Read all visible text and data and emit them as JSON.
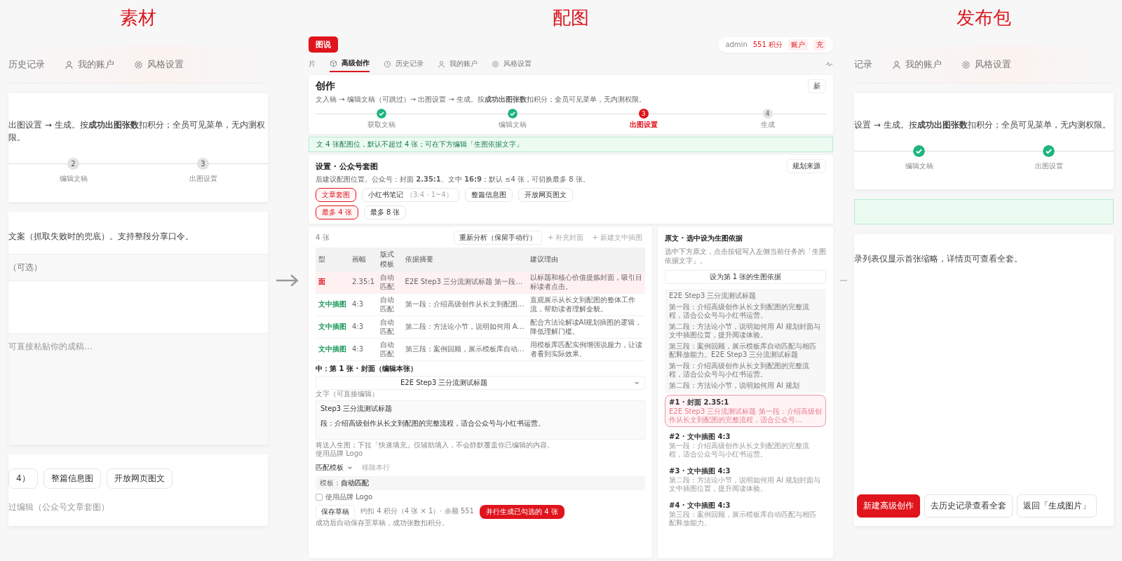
{
  "source_panel": {
    "title": "素材",
    "nav": [
      {
        "label": "历史记录",
        "kind": "plain",
        "selected": false
      },
      {
        "label": "我的账户",
        "kind": "account",
        "selected": false
      },
      {
        "label": "风格设置",
        "kind": "style",
        "selected": false
      }
    ],
    "intro": "出图设置 → 生成。按**成功出图张数**扣积分；全员可见菜单，无内测权限。",
    "steps": [
      {
        "number": "2",
        "label": "编辑文稿",
        "done": false,
        "current": false
      },
      {
        "number": "3",
        "label": "出图设置",
        "done": false,
        "current": false
      }
    ],
    "source_hint": "文案（抓取失败时的兜底）。支持整段分享口令。",
    "optional_label": "（可选）",
    "draft_placeholder": "可直接粘贴你的成稿…",
    "format_chips": [
      {
        "label": "4）",
        "selected": false
      },
      {
        "label": "整篇信息图",
        "selected": false
      },
      {
        "label": "开放网页图文",
        "selected": false
      }
    ],
    "footer_text": "过编辑（公众号文章套图）"
  },
  "figure_panel": {
    "title": "配图",
    "header": {
      "logo": "图说",
      "user": "admin",
      "points": "551 积分",
      "links": [
        "账户",
        "充"
      ]
    },
    "nav": [
      {
        "label": "片",
        "kind": "plain",
        "selected": false
      },
      {
        "label": "高级创作",
        "kind": "create",
        "selected": true
      },
      {
        "label": "历史记录",
        "kind": "history",
        "selected": false
      },
      {
        "label": "我的账户",
        "kind": "account",
        "selected": false
      },
      {
        "label": "风格设置",
        "kind": "style",
        "selected": false
      }
    ],
    "create_card": {
      "title": "创作",
      "action": "新",
      "intro": "文入稿 → 编辑文稿（可跳过）→ 出图设置 → 生成。按**成功出图张数**扣积分；全员可见菜单，无内测权限。",
      "steps": [
        {
          "label": "获取文稿",
          "done": true,
          "current": false
        },
        {
          "label": "编辑文稿",
          "done": true,
          "current": false
        },
        {
          "number": "3",
          "label": "出图设置",
          "done": false,
          "current": true
        },
        {
          "number": "4",
          "label": "生成",
          "done": false,
          "current": false
        }
      ]
    },
    "banner": "文 4 张配图位，默认不超过 4 张；可在下方编辑「生图依据文字」",
    "settings_card": {
      "title": "设置 · 公众号套图",
      "action": "规划来源",
      "intro": "后建议配图位置。公众号：封面 **2.35:1**、文中 **16:9**；默认 ≤4 张，可切换最多 8 张。",
      "format_chips": [
        {
          "label": "文章套图",
          "selected": true
        },
        {
          "label": "小红书笔记",
          "note": "（3:4 · 1~4）",
          "selected": false
        },
        {
          "label": "整篇信息图",
          "selected": false
        },
        {
          "label": "开放网页图文",
          "selected": false
        }
      ],
      "count_chips": [
        {
          "label": "最多 4 张",
          "selected": true
        },
        {
          "label": "最多 8 张",
          "selected": false
        }
      ]
    },
    "plan": {
      "count": "4 张",
      "actions": [
        {
          "label": "重新分析（保留手动行）",
          "kind": "secondary"
        },
        {
          "label": "+ 补充封面",
          "kind": "link"
        },
        {
          "label": "+ 新建文中插图",
          "kind": "link"
        }
      ],
      "table": {
        "columns": [
          "型",
          "画幅",
          "版式模板",
          "依据摘要",
          "建议理由"
        ],
        "rows": [
          {
            "type": "面",
            "color": "#e0141c",
            "selected": true,
            "ratio": "2.35:1",
            "template": "自动匹配",
            "summary": "E2E Step3 三分流测试标题 第一段…",
            "reason": "以标题和核心价值提炼封面，吸引目标读者点击。"
          },
          {
            "type": "文中插图",
            "color": "#1b9a5c",
            "selected": false,
            "ratio": "4:3",
            "template": "自动匹配",
            "summary": "第一段：介绍高级创作从长文到配图…",
            "reason": "直观展示从长文到配图的整体工作流，帮助读者理解全貌。"
          },
          {
            "type": "文中插图",
            "color": "#1b9a5c",
            "selected": false,
            "ratio": "4:3",
            "template": "自动匹配",
            "summary": "第二段：方法论小节，说明如何用 A…",
            "reason": "配合方法论解读AI规划插图的逻辑，降低理解门槛。"
          },
          {
            "type": "文中插图",
            "color": "#1b9a5c",
            "selected": false,
            "ratio": "4:3",
            "template": "自动匹配",
            "summary": "第三段：案例回顾，展示模板库自动…",
            "reason": "用模板库匹配实例增强说服力，让读者看到实际效果。"
          }
        ]
      }
    },
    "editor": {
      "title": "中：第 1 张 · 封面（编辑本张）",
      "select_value": "E2E Step3 三分流测试标题",
      "text_label": "文字（可直接编辑）",
      "text_lines": [
        "Step3 三分流测试标题",
        "段：介绍高级创作从长文到配图的完整流程，适合公众号与小红书运营。"
      ],
      "hint": "将送入生图；下拉「快速填充」仅辅助填入，不会静默覆盖你已编辑的内容。",
      "logo_note": "使用品牌 Logo",
      "template_select": "匹配模板",
      "remove": "移除本行",
      "template_info": "模板：**自动匹配**",
      "logo_checkbox": {
        "label": "使用品牌 Logo",
        "checked": false
      },
      "save": "保存草稿",
      "cost": "约扣 4 积分（4 张 × 1）· 余额 551",
      "generate": "并行生成已勾选的 4 张",
      "footnote": "成功后自动保存至草稿，成功张数扣积分。"
    },
    "sidebar": {
      "title": "原文 · 选中设为生图依据",
      "intro": "选中下方原文，点击按钮写入左侧当前任务的「生图依据文字」。",
      "button": "设为第 1 张的生图依据",
      "paragraphs": [
        "E2E Step3 三分流测试标题",
        "第一段：介绍高级创作从长文到配图的完整流程，适合公众号与小红书运营。",
        "第二段：方法论小节，说明如何用 AI 规划封面与文中插图位置，提升阅读体验。",
        "第三段：案例回顾，展示模板库自动匹配与相匹配释放能力。E2E Step3 三分流测试标题",
        "第一段：介绍高级创作从长文到配图的完整流程，适合公众号与小红书运营。",
        "第二段：方法论小节，说明如何用 AI 规划"
      ],
      "tasks": [
        {
          "title": "#1 · 封面 2.35:1",
          "excerpt": "E2E Step3 三分流测试标题 第一段：介绍高级创作从长文到配图的完整流程，适合公众号…",
          "selected": true
        },
        {
          "title": "#2 · 文中插图 4:3",
          "excerpt": "第一段：介绍高级创作从长文到配图的完整流程，适合公众号与小红书运营。",
          "selected": false
        },
        {
          "title": "#3 · 文中插图 4:3",
          "excerpt": "第二段：方法论小节，说明如何用 AI 规划封面与文中插图位置，提升阅读体验。",
          "selected": false
        },
        {
          "title": "#4 · 文中插图 4:3",
          "excerpt": "第三段：案例回顾，展示模板库自动匹配与相匹配释放能力。",
          "selected": false
        }
      ]
    }
  },
  "release_panel": {
    "title": "发布包",
    "nav": [
      {
        "label": "记录",
        "kind": "plain",
        "selected": false
      },
      {
        "label": "我的账户",
        "kind": "account",
        "selected": false
      },
      {
        "label": "风格设置",
        "kind": "style",
        "selected": false
      }
    ],
    "intro": "设置 → 生成。按**成功出图张数**扣积分；全员可见菜单，无内测权限。",
    "steps": [
      {
        "label": "编辑文稿",
        "done": true
      },
      {
        "label": "出图设置",
        "done": true
      }
    ],
    "note": "录列表仅显示首张缩略，详情页可查看全套。",
    "actions": [
      {
        "label": "新建高级创作",
        "kind": "primary"
      },
      {
        "label": "去历史记录查看全套",
        "kind": "secondary"
      },
      {
        "label": "返回「生成图片」",
        "kind": "secondary"
      }
    ]
  }
}
